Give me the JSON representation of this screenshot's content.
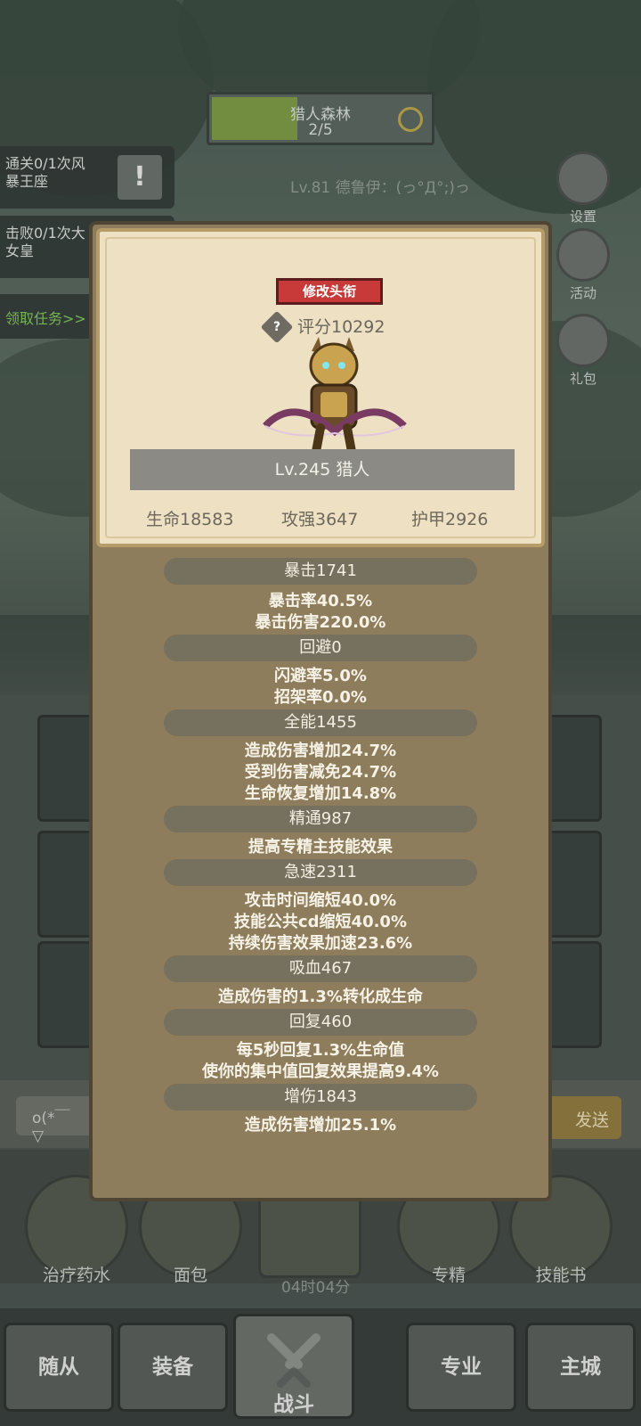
{
  "stage": {
    "name": "猎人森林",
    "progress": "2/5"
  },
  "quests": [
    {
      "line1": "通关0/1次风",
      "line2": "暴王座"
    },
    {
      "line1": "击败0/1次大",
      "line2": "女皇"
    }
  ],
  "quest_claim": "领取任务>>",
  "player_line": "Lv.81 德鲁伊：(っ°Д°;)っ",
  "side_buttons": {
    "settings": "设置",
    "event": "活动",
    "gift": "礼包"
  },
  "profile": {
    "title_button": "修改头衔",
    "score": "评分10292",
    "level_class": "Lv.245 猎人",
    "hp": "生命18583",
    "attack": "攻强3647",
    "armor": "护甲2926"
  },
  "attributes": [
    {
      "head": "暴击1741",
      "lines": [
        "暴击率40.5%",
        "暴击伤害220.0%"
      ]
    },
    {
      "head": "回避0",
      "lines": [
        "闪避率5.0%",
        "招架率0.0%"
      ]
    },
    {
      "head": "全能1455",
      "lines": [
        "造成伤害增加24.7%",
        "受到伤害减免24.7%",
        "生命恢复增加14.8%"
      ]
    },
    {
      "head": "精通987",
      "lines": [
        "提高专精主技能效果"
      ]
    },
    {
      "head": "急速2311",
      "lines": [
        "攻击时间缩短40.0%",
        "技能公共cd缩短40.0%",
        "持续伤害效果加速23.6%"
      ]
    },
    {
      "head": "吸血467",
      "lines": [
        "造成伤害的1.3%转化成生命"
      ]
    },
    {
      "head": "回复460",
      "lines": [
        "每5秒回复1.3%生命值",
        "使你的集中值回复效果提高9.4%"
      ]
    },
    {
      "head": "增伤1843",
      "lines": [
        "造成伤害增加25.1%"
      ]
    }
  ],
  "chat": {
    "input": "o(*￣▽",
    "send": "发送"
  },
  "items": {
    "potion": "治疗药水",
    "bread": "面包",
    "mastery": "专精",
    "skillbook": "技能书"
  },
  "timer": "04时04分",
  "nav": {
    "followers": "随从",
    "equipment": "装备",
    "battle": "战斗",
    "profession": "专业",
    "city": "主城"
  }
}
